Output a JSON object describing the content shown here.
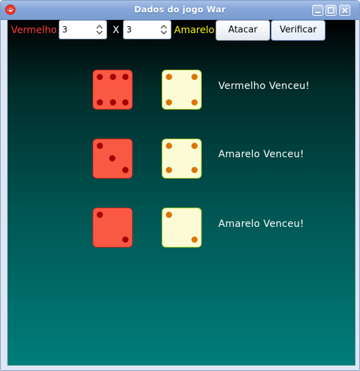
{
  "window": {
    "title": "Dados do jogo War"
  },
  "toolbar": {
    "red_label": "Vermelho",
    "red_count": "3",
    "versus": "X",
    "yellow_count": "3",
    "yellow_label": "Amarelo",
    "attack_button": "Atacar",
    "verify_button": "Verificar"
  },
  "rounds": [
    {
      "red_die": 6,
      "yellow_die": 4,
      "result": "Vermelho Venceu!"
    },
    {
      "red_die": 3,
      "yellow_die": 4,
      "result": "Amarelo Venceu!"
    },
    {
      "red_die": 2,
      "yellow_die": 2,
      "result": "Amarelo Venceu!"
    }
  ],
  "colors": {
    "red_label": "#ff3c3c",
    "yellow_label": "#f5f500",
    "red_die": "#fb5843",
    "yellow_die": "#fbfbd5"
  },
  "icons": {
    "app": "app-icon",
    "minimize": "minimize-icon",
    "maximize": "maximize-icon",
    "close": "close-icon"
  }
}
